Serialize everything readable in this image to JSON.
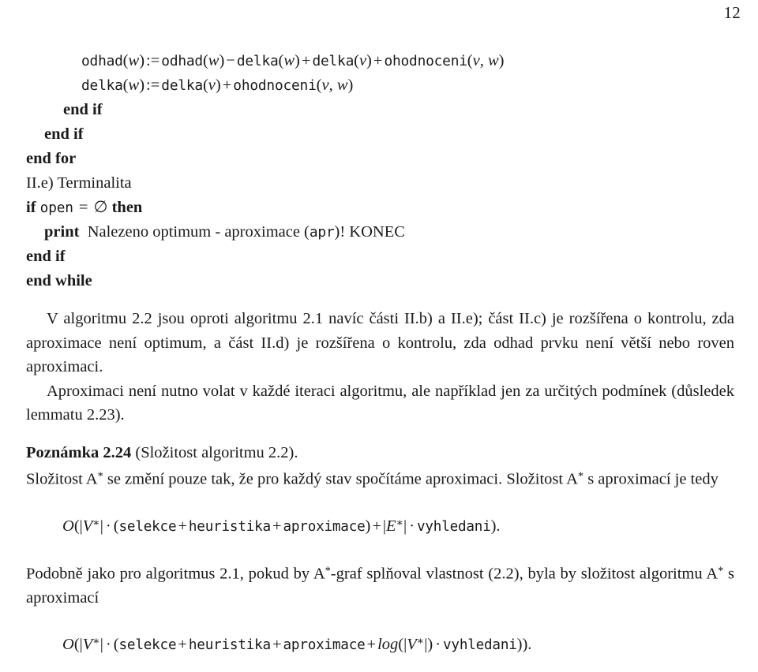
{
  "page": {
    "number": "12",
    "language": "cs"
  },
  "algorithm": {
    "lines": [
      {
        "indent": 3,
        "segments": [
          {
            "style": "tt",
            "text": "odhad"
          },
          {
            "style": "paren",
            "text": "("
          },
          {
            "style": "mi",
            "text": "w"
          },
          {
            "style": "paren",
            "text": ")"
          },
          {
            "style": "op",
            "text": ":="
          },
          {
            "style": "tt",
            "text": "odhad"
          },
          {
            "style": "paren",
            "text": "("
          },
          {
            "style": "mi",
            "text": "w"
          },
          {
            "style": "paren",
            "text": ")"
          },
          {
            "style": "op",
            "text": "−"
          },
          {
            "style": "tt",
            "text": "delka"
          },
          {
            "style": "paren",
            "text": "("
          },
          {
            "style": "mi",
            "text": "w"
          },
          {
            "style": "paren",
            "text": ")"
          },
          {
            "style": "op",
            "text": "+"
          },
          {
            "style": "tt",
            "text": "delka"
          },
          {
            "style": "paren",
            "text": "("
          },
          {
            "style": "mi",
            "text": "v"
          },
          {
            "style": "paren",
            "text": ")"
          },
          {
            "style": "op",
            "text": "+"
          },
          {
            "style": "tt",
            "text": "ohodnoceni"
          },
          {
            "style": "paren",
            "text": "("
          },
          {
            "style": "mi",
            "text": "v"
          },
          {
            "style": "paren",
            "text": ", "
          },
          {
            "style": "mi",
            "text": "w"
          },
          {
            "style": "paren",
            "text": ")"
          }
        ],
        "plain": "odhad(w) := odhad(w) − delka(w) + delka(v) + ohodnoceni(v, w)"
      },
      {
        "indent": 3,
        "segments": [
          {
            "style": "tt",
            "text": "delka"
          },
          {
            "style": "paren",
            "text": "("
          },
          {
            "style": "mi",
            "text": "w"
          },
          {
            "style": "paren",
            "text": ")"
          },
          {
            "style": "op",
            "text": ":="
          },
          {
            "style": "tt",
            "text": "delka"
          },
          {
            "style": "paren",
            "text": "("
          },
          {
            "style": "mi",
            "text": "v"
          },
          {
            "style": "paren",
            "text": ")"
          },
          {
            "style": "op",
            "text": "+"
          },
          {
            "style": "tt",
            "text": "ohodnoceni"
          },
          {
            "style": "paren",
            "text": "("
          },
          {
            "style": "mi",
            "text": "v"
          },
          {
            "style": "paren",
            "text": ", "
          },
          {
            "style": "mi",
            "text": "w"
          },
          {
            "style": "paren",
            "text": ")"
          }
        ],
        "plain": "delka(w) := delka(v) + ohodnoceni(v, w)"
      },
      {
        "indent": 2,
        "segments": [
          {
            "style": "kw",
            "text": "end if"
          }
        ],
        "plain": "end if"
      },
      {
        "indent": 1,
        "segments": [
          {
            "style": "kw",
            "text": "end if"
          }
        ],
        "plain": "end if"
      },
      {
        "indent": 0,
        "segments": [
          {
            "style": "kw",
            "text": "end for"
          }
        ],
        "plain": "end for"
      },
      {
        "indent": 0,
        "segments": [
          {
            "style": "rm",
            "text": "II.e) Terminalita"
          }
        ],
        "plain": "II.e) Terminalita"
      },
      {
        "indent": 0,
        "segments": [
          {
            "style": "kw",
            "text": "if"
          },
          {
            "style": "rm",
            "text": " "
          },
          {
            "style": "tt",
            "text": "open"
          },
          {
            "style": "op",
            "text": " = "
          },
          {
            "style": "rm",
            "text": "∅"
          },
          {
            "style": "rm",
            "text": " "
          },
          {
            "style": "kw",
            "text": "then"
          }
        ],
        "plain": "if open = ∅ then"
      },
      {
        "indent": 1,
        "segments": [
          {
            "style": "kw",
            "text": "print"
          },
          {
            "style": "rm",
            "text": "  Nalezeno optimum - aproximace ("
          },
          {
            "style": "tt",
            "text": "apr"
          },
          {
            "style": "rm",
            "text": ")! KONEC"
          }
        ],
        "plain": "print  Nalezeno optimum - aproximace (apr)! KONEC"
      },
      {
        "indent": 0,
        "segments": [
          {
            "style": "kw",
            "text": "end if"
          }
        ],
        "plain": "end if"
      },
      {
        "indent": 0,
        "segments": [
          {
            "style": "kw",
            "text": "end while"
          }
        ],
        "plain": "end while"
      }
    ]
  },
  "body": {
    "paragraph_1": "V algoritmu 2.2 jsou oproti algoritmu 2.1 navíc části II.b) a II.e); část II.c) je rozšířena o kontrolu, zda aproximace není optimum, a část II.d) je rozšířena o kontrolu, zda odhad prvku není větší nebo roven aproximaci.",
    "paragraph_2": "Aproximaci není nutno volat v každé iteraci algoritmu, ale například jen za určitých podmínek (důsledek lemmatu 2.23).",
    "note_label": "Poznámka 2.24",
    "note_title": " (Složitost algoritmu 2.2).",
    "paragraph_3_pre": "Složitost A",
    "paragraph_3_post": " se změní pouze tak, že pro každý stav spočítáme aproximaci. Složitost A",
    "paragraph_3_tail": " s aproximací je tedy",
    "paragraph_4_pre": "Podobně jako pro algoritmus 2.1, pokud by A",
    "paragraph_4_mid": "-graf splňoval vlastnost (2.2), byla by složitost algoritmu A",
    "paragraph_4_tail": " s aproximací",
    "asterisk": "*"
  },
  "equations": {
    "eq1": {
      "bigO": "O",
      "open": "(|",
      "var_v": "V",
      "star": "∗",
      "close_bar": "|",
      "dot": "·",
      "terms_open": "(",
      "t1": "selekce",
      "plus1": "+",
      "t2": "heuristika",
      "plus2": "+",
      "t3": "aproximace",
      "terms_close": ")",
      "plus3": "+",
      "var_e": "E",
      "t4": "vyhledani",
      "tail": ").",
      "plain": "O(|V∗| · (selekce + heuristika + aproximace) + |E∗| · vyhledani)."
    },
    "eq2": {
      "bigO": "O",
      "var_v": "V",
      "star": "∗",
      "t1": "selekce",
      "t2": "heuristika",
      "t3": "aproximace",
      "log": "log",
      "t4": "vyhledani",
      "tail": ")).",
      "plain": "O(|V∗| · (selekce + heuristika + aproximace + log(|V∗|) · vyhledani))."
    }
  }
}
